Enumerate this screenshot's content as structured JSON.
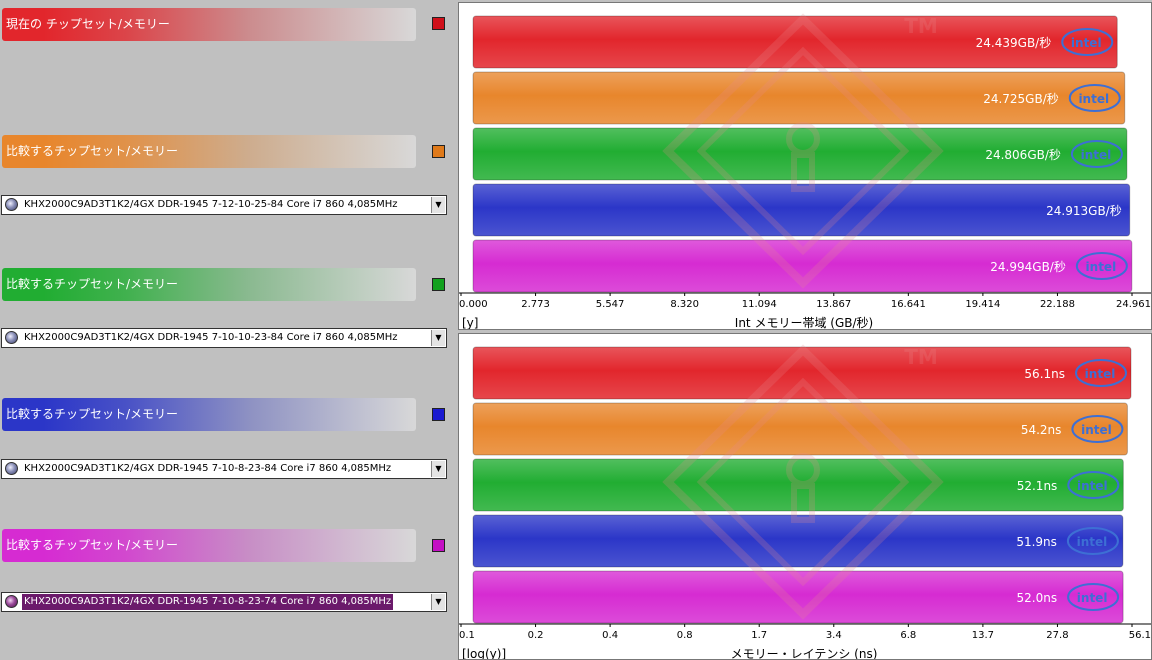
{
  "colors": {
    "red": "#e2262c",
    "orange": "#e8862c",
    "green": "#21ad32",
    "blue": "#2b36c8",
    "magenta": "#d62bd2",
    "watermark": "#e88a8f",
    "intel_ring": "#3d6fd4"
  },
  "legend": {
    "items": [
      {
        "label": "現在の チップセット/メモリー",
        "color": "#e2262c",
        "swatch": "#d0101a"
      },
      {
        "label": "比較するチップセット/メモリー",
        "color": "#e8862c",
        "swatch": "#e07a1a",
        "selection": "KHX2000C9AD3T1K2/4GX DDR-1945 7-12-10-25-84 Core i7 860 4,085MHz",
        "selected": false
      },
      {
        "label": "比較するチップセット/メモリー",
        "color": "#21ad32",
        "swatch": "#12a11e",
        "selection": "KHX2000C9AD3T1K2/4GX DDR-1945 7-10-10-23-84 Core i7 860 4,085MHz",
        "selected": false
      },
      {
        "label": "比較するチップセット/メモリー",
        "color": "#2b36c8",
        "swatch": "#1a1ad0",
        "selection": "KHX2000C9AD3T1K2/4GX DDR-1945 7-10-8-23-84 Core i7 860 4,085MHz",
        "selected": false
      },
      {
        "label": "比較するチップセット/メモリー",
        "color": "#d62bd2",
        "swatch": "#c410c4",
        "selection": "KHX2000C9AD3T1K2/4GX DDR-1945 7-10-8-23-74 Core i7 860 4,085MHz",
        "selected": true
      }
    ]
  },
  "watermark": {
    "tm": "TM"
  },
  "chart_data": [
    {
      "type": "bar",
      "orientation": "horizontal",
      "xlabel": "Int メモリー帯域 (GB/秒)",
      "scale_label": "[y]",
      "scale": "linear",
      "xlim": [
        0,
        24.961
      ],
      "ticks": [
        "0.000",
        "2.773",
        "5.547",
        "8.320",
        "11.094",
        "13.867",
        "16.641",
        "19.414",
        "22.188",
        "24.961"
      ],
      "values": [
        24.439,
        24.725,
        24.806,
        24.913,
        24.994
      ],
      "value_labels": [
        "24.439GB/秒",
        "24.725GB/秒",
        "24.806GB/秒",
        "24.913GB/秒",
        "24.994GB/秒"
      ],
      "colors": [
        "#e2262c",
        "#e8862c",
        "#21ad32",
        "#2b36c8",
        "#d62bd2"
      ],
      "intel_logo": [
        true,
        true,
        true,
        false,
        true
      ],
      "logo_text": "intel"
    },
    {
      "type": "bar",
      "orientation": "horizontal",
      "xlabel": "メモリー・レイテンシ (ns)",
      "scale_label": "[log(y)]",
      "scale": "log",
      "xlim": [
        0.1,
        56.1
      ],
      "ticks": [
        "0.1",
        "0.2",
        "0.4",
        "0.8",
        "1.7",
        "3.4",
        "6.8",
        "13.7",
        "27.8",
        "56.1"
      ],
      "values": [
        56.1,
        54.2,
        52.1,
        51.9,
        52.0
      ],
      "value_labels": [
        "56.1ns",
        "54.2ns",
        "52.1ns",
        "51.9ns",
        "52.0ns"
      ],
      "colors": [
        "#e2262c",
        "#e8862c",
        "#21ad32",
        "#2b36c8",
        "#d62bd2"
      ],
      "intel_logo": [
        true,
        true,
        true,
        true,
        true
      ],
      "logo_text": "intel"
    }
  ]
}
